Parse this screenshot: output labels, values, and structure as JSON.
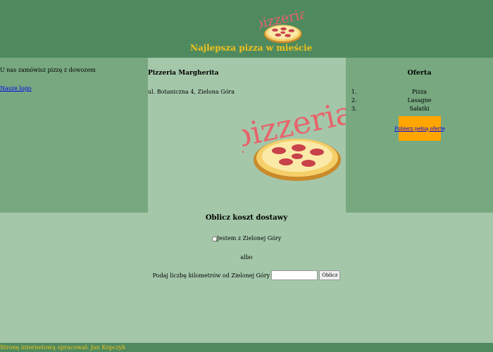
{
  "header": {
    "logo_text": "pizzeria",
    "tagline": "Najlepsza pizza w mieście"
  },
  "left": {
    "text": "U nas zamówisz pizzę z dowozem",
    "link": "Nasze logo"
  },
  "middle": {
    "title": "Pizzeria Margherita",
    "address": "ul. Botaniczna 4, Zielona Góra",
    "logo_text": "pizzeria"
  },
  "right": {
    "title": "Oferta",
    "items": [
      {
        "num": "1.",
        "label": "Pizza"
      },
      {
        "num": "2.",
        "label": "Lasagne"
      },
      {
        "num": "3.",
        "label": "Sałatki"
      }
    ],
    "button_label": "Pobierz pełną ofertę"
  },
  "delivery": {
    "title": "Oblicz koszt dostawy",
    "local_label": "Jestem z Zielonej Góry",
    "or_text": "albo",
    "km_label": "Podaj liczbę kilometrów od Zielonej Góry",
    "km_value": "",
    "calc_label": "Oblicz"
  },
  "footer": {
    "text": "Stronę internetową opracował: Jan Kopczyk"
  },
  "colors": {
    "header_bg": "#4f8a5f",
    "side_bg": "#77a880",
    "main_bg": "#a4c7a9",
    "accent_yellow": "#f2c21b",
    "button_orange": "#ffa500",
    "logo_red": "#e8636b"
  }
}
